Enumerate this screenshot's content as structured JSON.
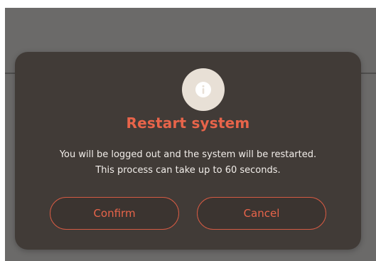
{
  "dialog": {
    "icon": "info-icon",
    "title": "Restart system",
    "message_line1": "You will be logged out and the system will be restarted.",
    "message_line2": "This process can take up to 60 seconds.",
    "confirm_label": "Confirm",
    "cancel_label": "Cancel"
  },
  "colors": {
    "accent": "#e8644a",
    "dialog_bg": "#413b37",
    "overlay_bg": "#6b6a69",
    "icon_circle": "#e8e0d6",
    "text": "#f2eeea"
  }
}
